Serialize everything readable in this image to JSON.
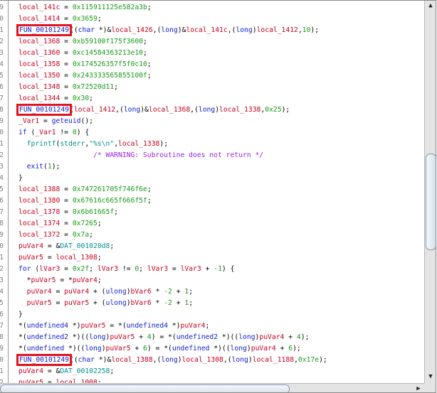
{
  "colors": {
    "variable": "#c8001e",
    "number": "#1a9a1a",
    "function": "#1020d0",
    "global": "#00908c",
    "comment": "#9a20e8",
    "highlight_box": "#e0141e"
  },
  "scrollbar": {
    "up_icon": "triangle-up",
    "down_icon": "triangle-down",
    "right_icon": "triangle-right"
  },
  "lines": [
    {
      "num": "9",
      "tokens": [
        [
          "local_141c",
          "v"
        ],
        [
          " = ",
          "p"
        ],
        [
          "0x115911125e582a3b",
          "n"
        ],
        [
          ";",
          "p"
        ]
      ]
    },
    {
      "num": "0",
      "tokens": [
        [
          "local_1414",
          "v"
        ],
        [
          " = ",
          "p"
        ],
        [
          "0x3659",
          "n"
        ],
        [
          ";",
          "p"
        ]
      ]
    },
    {
      "num": "1",
      "tokens": [
        [
          "FUN_00101249",
          "f",
          "box"
        ],
        [
          "((",
          "p"
        ],
        [
          "char",
          "k"
        ],
        [
          " *)&",
          "p"
        ],
        [
          "local_1426",
          "v"
        ],
        [
          ",(",
          "p"
        ],
        [
          "long",
          "k"
        ],
        [
          ")&",
          "p"
        ],
        [
          "local_141c",
          "v"
        ],
        [
          ",(",
          "p"
        ],
        [
          "long",
          "k"
        ],
        [
          ")",
          "p"
        ],
        [
          "local_1412",
          "v"
        ],
        [
          ",",
          "p"
        ],
        [
          "10",
          "n"
        ],
        [
          ");",
          "p"
        ]
      ]
    },
    {
      "num": "2",
      "tokens": [
        [
          "local_1368",
          "v"
        ],
        [
          " = ",
          "p"
        ],
        [
          "0xb59100f175f3600",
          "n"
        ],
        [
          ";",
          "p"
        ]
      ]
    },
    {
      "num": "3",
      "tokens": [
        [
          "local_1360",
          "v"
        ],
        [
          " = ",
          "p"
        ],
        [
          "0xc14584363213e10",
          "n"
        ],
        [
          ";",
          "p"
        ]
      ]
    },
    {
      "num": "4",
      "tokens": [
        [
          "local_1358",
          "v"
        ],
        [
          " = ",
          "p"
        ],
        [
          "0x174526357f5f0c10",
          "n"
        ],
        [
          ";",
          "p"
        ]
      ]
    },
    {
      "num": "5",
      "tokens": [
        [
          "local_1350",
          "v"
        ],
        [
          " = ",
          "p"
        ],
        [
          "0x243333565855100f",
          "n"
        ],
        [
          ";",
          "p"
        ]
      ]
    },
    {
      "num": "6",
      "tokens": [
        [
          "local_1348",
          "v"
        ],
        [
          " = ",
          "p"
        ],
        [
          "0x72520d11",
          "n"
        ],
        [
          ";",
          "p"
        ]
      ]
    },
    {
      "num": "7",
      "tokens": [
        [
          "local_1344",
          "v"
        ],
        [
          " = ",
          "p"
        ],
        [
          "0x30",
          "n"
        ],
        [
          ";",
          "p"
        ]
      ]
    },
    {
      "num": "8",
      "tokens": [
        [
          "FUN_00101249",
          "f",
          "box"
        ],
        [
          "(",
          "p"
        ],
        [
          "local_1412",
          "v"
        ],
        [
          ",(",
          "p"
        ],
        [
          "long",
          "k"
        ],
        [
          ")&",
          "p"
        ],
        [
          "local_1368",
          "v"
        ],
        [
          ",(",
          "p"
        ],
        [
          "long",
          "k"
        ],
        [
          ")",
          "p"
        ],
        [
          "local_1338",
          "v"
        ],
        [
          ",",
          "p"
        ],
        [
          "0x25",
          "n"
        ],
        [
          ");",
          "p"
        ]
      ]
    },
    {
      "num": "9",
      "tokens": [
        [
          "_Var1",
          "v"
        ],
        [
          " = ",
          "p"
        ],
        [
          "geteuid",
          "f"
        ],
        [
          "();",
          "p"
        ]
      ]
    },
    {
      "num": "0",
      "tokens": [
        [
          "if",
          "k"
        ],
        [
          " (",
          "p"
        ],
        [
          "_Var1",
          "v"
        ],
        [
          " != ",
          "p"
        ],
        [
          "0",
          "n"
        ],
        [
          ") {",
          "p"
        ]
      ]
    },
    {
      "num": "1",
      "tokens": [
        [
          "  ",
          "p"
        ],
        [
          "fprintf",
          "g"
        ],
        [
          "(",
          "p"
        ],
        [
          "stderr",
          "g"
        ],
        [
          ",",
          "p"
        ],
        [
          "\"%s\\n\"",
          "s"
        ],
        [
          ",",
          "p"
        ],
        [
          "local_1338",
          "v"
        ],
        [
          ");",
          "p"
        ]
      ]
    },
    {
      "num": "2",
      "tokens": [
        [
          "                  ",
          "p"
        ],
        [
          "/* WARNING: Subroutine does not return */",
          "c"
        ]
      ]
    },
    {
      "num": "3",
      "tokens": [
        [
          "  ",
          "p"
        ],
        [
          "exit",
          "f"
        ],
        [
          "(",
          "p"
        ],
        [
          "1",
          "n"
        ],
        [
          ");",
          "p"
        ]
      ]
    },
    {
      "num": "4",
      "tokens": [
        [
          "}",
          "p"
        ]
      ]
    },
    {
      "num": "5",
      "tokens": [
        [
          "local_1388",
          "v"
        ],
        [
          " = ",
          "p"
        ],
        [
          "0x747261705f746f6e",
          "n"
        ],
        [
          ";",
          "p"
        ]
      ]
    },
    {
      "num": "6",
      "tokens": [
        [
          "local_1380",
          "v"
        ],
        [
          " = ",
          "p"
        ],
        [
          "0x67616c665f666f5f",
          "n"
        ],
        [
          ";",
          "p"
        ]
      ]
    },
    {
      "num": "7",
      "tokens": [
        [
          "local_1378",
          "v"
        ],
        [
          " = ",
          "p"
        ],
        [
          "0x6b61665f",
          "n"
        ],
        [
          ";",
          "p"
        ]
      ]
    },
    {
      "num": "8",
      "tokens": [
        [
          "local_1374",
          "v"
        ],
        [
          " = ",
          "p"
        ],
        [
          "0x7265",
          "n"
        ],
        [
          ";",
          "p"
        ]
      ]
    },
    {
      "num": "9",
      "tokens": [
        [
          "local_1372",
          "v"
        ],
        [
          " = ",
          "p"
        ],
        [
          "0x7a",
          "n"
        ],
        [
          ";",
          "p"
        ]
      ]
    },
    {
      "num": "0",
      "tokens": [
        [
          "puVar4",
          "v"
        ],
        [
          " = &",
          "p"
        ],
        [
          "DAT_001020d8",
          "g"
        ],
        [
          ";",
          "p"
        ]
      ]
    },
    {
      "num": "1",
      "tokens": [
        [
          "puVar5",
          "v"
        ],
        [
          " = ",
          "p"
        ],
        [
          "local_1308",
          "v"
        ],
        [
          ";",
          "p"
        ]
      ]
    },
    {
      "num": "2",
      "tokens": [
        [
          "for",
          "k"
        ],
        [
          " (",
          "p"
        ],
        [
          "lVar3",
          "v"
        ],
        [
          " = ",
          "p"
        ],
        [
          "0x2f",
          "n"
        ],
        [
          "; ",
          "p"
        ],
        [
          "lVar3",
          "v"
        ],
        [
          " != ",
          "p"
        ],
        [
          "0",
          "n"
        ],
        [
          "; ",
          "p"
        ],
        [
          "lVar3",
          "v"
        ],
        [
          " = ",
          "p"
        ],
        [
          "lVar3",
          "v"
        ],
        [
          " + ",
          "p"
        ],
        [
          "-1",
          "n"
        ],
        [
          ") {",
          "p"
        ]
      ]
    },
    {
      "num": "3",
      "tokens": [
        [
          "  *",
          "p"
        ],
        [
          "puVar5",
          "v"
        ],
        [
          " = *",
          "p"
        ],
        [
          "puVar4",
          "v"
        ],
        [
          ";",
          "p"
        ]
      ]
    },
    {
      "num": "4",
      "tokens": [
        [
          "  ",
          "p"
        ],
        [
          "puVar4",
          "v"
        ],
        [
          " = ",
          "p"
        ],
        [
          "puVar4",
          "v"
        ],
        [
          " + (",
          "p"
        ],
        [
          "ulong",
          "k"
        ],
        [
          ")",
          "p"
        ],
        [
          "bVar6",
          "v"
        ],
        [
          " * ",
          "p"
        ],
        [
          "-2",
          "n"
        ],
        [
          " + ",
          "p"
        ],
        [
          "1",
          "n"
        ],
        [
          ";",
          "p"
        ]
      ]
    },
    {
      "num": "5",
      "tokens": [
        [
          "  ",
          "p"
        ],
        [
          "puVar5",
          "v"
        ],
        [
          " = ",
          "p"
        ],
        [
          "puVar5",
          "v"
        ],
        [
          " + (",
          "p"
        ],
        [
          "ulong",
          "k"
        ],
        [
          ")",
          "p"
        ],
        [
          "bVar6",
          "v"
        ],
        [
          " * ",
          "p"
        ],
        [
          "-2",
          "n"
        ],
        [
          " + ",
          "p"
        ],
        [
          "1",
          "n"
        ],
        [
          ";",
          "p"
        ]
      ]
    },
    {
      "num": "6",
      "tokens": [
        [
          "}",
          "p"
        ]
      ]
    },
    {
      "num": "7",
      "tokens": [
        [
          "*(",
          "p"
        ],
        [
          "undefined4",
          "k"
        ],
        [
          " *)",
          "p"
        ],
        [
          "puVar5",
          "v"
        ],
        [
          " = *(",
          "p"
        ],
        [
          "undefined4",
          "k"
        ],
        [
          " *)",
          "p"
        ],
        [
          "puVar4",
          "v"
        ],
        [
          ";",
          "p"
        ]
      ]
    },
    {
      "num": "8",
      "tokens": [
        [
          "*(",
          "p"
        ],
        [
          "undefined2",
          "k"
        ],
        [
          " *)((",
          "p"
        ],
        [
          "long",
          "k"
        ],
        [
          ")",
          "p"
        ],
        [
          "puVar5",
          "v"
        ],
        [
          " + ",
          "p"
        ],
        [
          "4",
          "n"
        ],
        [
          ") = *(",
          "p"
        ],
        [
          "undefined2",
          "k"
        ],
        [
          " *)((",
          "p"
        ],
        [
          "long",
          "k"
        ],
        [
          ")",
          "p"
        ],
        [
          "puVar4",
          "v"
        ],
        [
          " + ",
          "p"
        ],
        [
          "4",
          "n"
        ],
        [
          ");",
          "p"
        ]
      ]
    },
    {
      "num": "9",
      "tokens": [
        [
          "*(",
          "p"
        ],
        [
          "undefined",
          "k"
        ],
        [
          " *)((",
          "p"
        ],
        [
          "long",
          "k"
        ],
        [
          ")",
          "p"
        ],
        [
          "puVar5",
          "v"
        ],
        [
          " + ",
          "p"
        ],
        [
          "6",
          "n"
        ],
        [
          ") = *(",
          "p"
        ],
        [
          "undefined",
          "k"
        ],
        [
          " *)((",
          "p"
        ],
        [
          "long",
          "k"
        ],
        [
          ")",
          "p"
        ],
        [
          "puVar4",
          "v"
        ],
        [
          " + ",
          "p"
        ],
        [
          "6",
          "n"
        ],
        [
          ");",
          "p"
        ]
      ]
    },
    {
      "num": "0",
      "tokens": [
        [
          "FUN_00101249",
          "f",
          "box"
        ],
        [
          "((",
          "p"
        ],
        [
          "char",
          "k"
        ],
        [
          " *)&",
          "p"
        ],
        [
          "local_1388",
          "v"
        ],
        [
          ",(",
          "p"
        ],
        [
          "long",
          "k"
        ],
        [
          ")",
          "p"
        ],
        [
          "local_1308",
          "v"
        ],
        [
          ",(",
          "p"
        ],
        [
          "long",
          "k"
        ],
        [
          ")",
          "p"
        ],
        [
          "local_1188",
          "v"
        ],
        [
          ",",
          "p"
        ],
        [
          "0x17e",
          "n"
        ],
        [
          ");",
          "p"
        ]
      ]
    },
    {
      "num": "1",
      "tokens": [
        [
          "puVar4",
          "v"
        ],
        [
          " = &",
          "p"
        ],
        [
          "DAT_00102258",
          "g"
        ],
        [
          ";",
          "p"
        ]
      ]
    },
    {
      "num": "2",
      "tokens": [
        [
          "puVar5",
          "v"
        ],
        [
          " = ",
          "p"
        ],
        [
          "local_1008",
          "v"
        ],
        [
          ";",
          "p"
        ]
      ]
    }
  ]
}
